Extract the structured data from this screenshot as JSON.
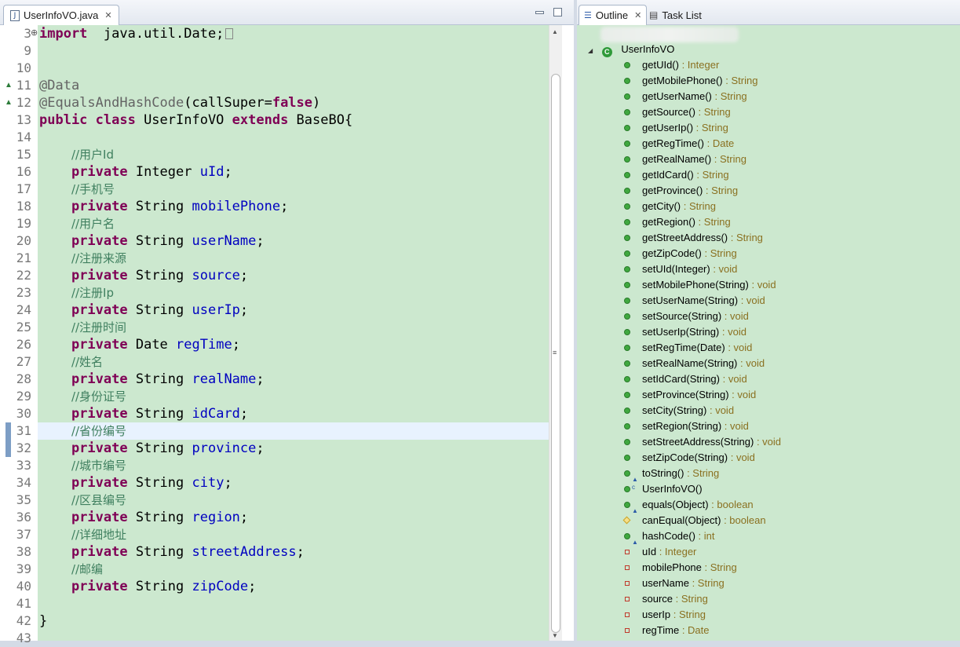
{
  "editor": {
    "tab_label": "UserInfoVO.java",
    "lines": [
      {
        "n": "3",
        "fold": "plus",
        "parts": [
          [
            "kw",
            "import"
          ],
          [
            "",
            "  java.util.Date;"
          ]
        ],
        "box": true
      },
      {
        "n": "9",
        "parts": []
      },
      {
        "n": "10",
        "parts": []
      },
      {
        "n": "11",
        "fold": "tri",
        "parts": [
          [
            "an",
            "@Data"
          ]
        ]
      },
      {
        "n": "12",
        "fold": "tri",
        "parts": [
          [
            "an",
            "@EqualsAndHashCode"
          ],
          [
            "",
            "(callSuper="
          ],
          [
            "kw",
            "false"
          ],
          [
            "",
            ")"
          ]
        ]
      },
      {
        "n": "13",
        "parts": [
          [
            "kw",
            "public class"
          ],
          [
            "",
            " UserInfoVO "
          ],
          [
            "kw",
            "extends"
          ],
          [
            "",
            " BaseBO{"
          ]
        ]
      },
      {
        "n": "14",
        "parts": []
      },
      {
        "n": "15",
        "parts": [
          [
            "",
            "    "
          ],
          [
            "cm",
            "//用户Id"
          ]
        ]
      },
      {
        "n": "16",
        "parts": [
          [
            "",
            "    "
          ],
          [
            "kw",
            "private"
          ],
          [
            "",
            " Integer "
          ],
          [
            "fd",
            "uId"
          ],
          [
            "",
            ";"
          ]
        ]
      },
      {
        "n": "17",
        "parts": [
          [
            "",
            "    "
          ],
          [
            "cm",
            "//手机号"
          ]
        ]
      },
      {
        "n": "18",
        "parts": [
          [
            "",
            "    "
          ],
          [
            "kw",
            "private"
          ],
          [
            "",
            " String "
          ],
          [
            "fd",
            "mobilePhone"
          ],
          [
            "",
            ";"
          ]
        ]
      },
      {
        "n": "19",
        "parts": [
          [
            "",
            "    "
          ],
          [
            "cm",
            "//用户名"
          ]
        ]
      },
      {
        "n": "20",
        "parts": [
          [
            "",
            "    "
          ],
          [
            "kw",
            "private"
          ],
          [
            "",
            " String "
          ],
          [
            "fd",
            "userName"
          ],
          [
            "",
            ";"
          ]
        ]
      },
      {
        "n": "21",
        "parts": [
          [
            "",
            "    "
          ],
          [
            "cm",
            "//注册来源"
          ]
        ]
      },
      {
        "n": "22",
        "parts": [
          [
            "",
            "    "
          ],
          [
            "kw",
            "private"
          ],
          [
            "",
            " String "
          ],
          [
            "fd",
            "source"
          ],
          [
            "",
            ";"
          ]
        ]
      },
      {
        "n": "23",
        "parts": [
          [
            "",
            "    "
          ],
          [
            "cm",
            "//注册Ip"
          ]
        ]
      },
      {
        "n": "24",
        "parts": [
          [
            "",
            "    "
          ],
          [
            "kw",
            "private"
          ],
          [
            "",
            " String "
          ],
          [
            "fd",
            "userIp"
          ],
          [
            "",
            ";"
          ]
        ]
      },
      {
        "n": "25",
        "parts": [
          [
            "",
            "    "
          ],
          [
            "cm",
            "//注册时间"
          ]
        ]
      },
      {
        "n": "26",
        "parts": [
          [
            "",
            "    "
          ],
          [
            "kw",
            "private"
          ],
          [
            "",
            " Date "
          ],
          [
            "fd",
            "regTime"
          ],
          [
            "",
            ";"
          ]
        ]
      },
      {
        "n": "27",
        "parts": [
          [
            "",
            "    "
          ],
          [
            "cm",
            "//姓名"
          ]
        ]
      },
      {
        "n": "28",
        "parts": [
          [
            "",
            "    "
          ],
          [
            "kw",
            "private"
          ],
          [
            "",
            " String "
          ],
          [
            "fd",
            "realName"
          ],
          [
            "",
            ";"
          ]
        ]
      },
      {
        "n": "29",
        "parts": [
          [
            "",
            "    "
          ],
          [
            "cm",
            "//身份证号"
          ]
        ]
      },
      {
        "n": "30",
        "parts": [
          [
            "",
            "    "
          ],
          [
            "kw",
            "private"
          ],
          [
            "",
            " String "
          ],
          [
            "fd",
            "idCard"
          ],
          [
            "",
            ";"
          ]
        ]
      },
      {
        "n": "31",
        "hl": true,
        "parts": [
          [
            "",
            "    "
          ],
          [
            "cm",
            "//省份编号"
          ]
        ]
      },
      {
        "n": "32",
        "parts": [
          [
            "",
            "    "
          ],
          [
            "kw",
            "private"
          ],
          [
            "",
            " String "
          ],
          [
            "fd",
            "province"
          ],
          [
            "",
            ";"
          ]
        ]
      },
      {
        "n": "33",
        "parts": [
          [
            "",
            "    "
          ],
          [
            "cm",
            "//城市编号"
          ]
        ]
      },
      {
        "n": "34",
        "parts": [
          [
            "",
            "    "
          ],
          [
            "kw",
            "private"
          ],
          [
            "",
            " String "
          ],
          [
            "fd",
            "city"
          ],
          [
            "",
            ";"
          ]
        ]
      },
      {
        "n": "35",
        "parts": [
          [
            "",
            "    "
          ],
          [
            "cm",
            "//区县编号"
          ]
        ]
      },
      {
        "n": "36",
        "parts": [
          [
            "",
            "    "
          ],
          [
            "kw",
            "private"
          ],
          [
            "",
            " String "
          ],
          [
            "fd",
            "region"
          ],
          [
            "",
            ";"
          ]
        ]
      },
      {
        "n": "37",
        "parts": [
          [
            "",
            "    "
          ],
          [
            "cm",
            "//详细地址"
          ]
        ]
      },
      {
        "n": "38",
        "parts": [
          [
            "",
            "    "
          ],
          [
            "kw",
            "private"
          ],
          [
            "",
            " String "
          ],
          [
            "fd",
            "streetAddress"
          ],
          [
            "",
            ";"
          ]
        ]
      },
      {
        "n": "39",
        "parts": [
          [
            "",
            "    "
          ],
          [
            "cm",
            "//邮编"
          ]
        ]
      },
      {
        "n": "40",
        "parts": [
          [
            "",
            "    "
          ],
          [
            "kw",
            "private"
          ],
          [
            "",
            " String "
          ],
          [
            "fd",
            "zipCode"
          ],
          [
            "",
            ";"
          ]
        ]
      },
      {
        "n": "41",
        "parts": []
      },
      {
        "n": "42",
        "parts": [
          [
            "",
            "}"
          ]
        ]
      },
      {
        "n": "43",
        "parts": []
      }
    ]
  },
  "outline": {
    "tab_outline": "Outline",
    "tab_tasks": "Task List",
    "root": "UserInfoVO",
    "items": [
      {
        "name": "getUId()",
        "type": " : Integer",
        "icon": "pub"
      },
      {
        "name": "getMobilePhone()",
        "type": " : String",
        "icon": "pub"
      },
      {
        "name": "getUserName()",
        "type": " : String",
        "icon": "pub"
      },
      {
        "name": "getSource()",
        "type": " : String",
        "icon": "pub"
      },
      {
        "name": "getUserIp()",
        "type": " : String",
        "icon": "pub"
      },
      {
        "name": "getRegTime()",
        "type": " : Date",
        "icon": "pub"
      },
      {
        "name": "getRealName()",
        "type": " : String",
        "icon": "pub"
      },
      {
        "name": "getIdCard()",
        "type": " : String",
        "icon": "pub"
      },
      {
        "name": "getProvince()",
        "type": " : String",
        "icon": "pub"
      },
      {
        "name": "getCity()",
        "type": " : String",
        "icon": "pub"
      },
      {
        "name": "getRegion()",
        "type": " : String",
        "icon": "pub"
      },
      {
        "name": "getStreetAddress()",
        "type": " : String",
        "icon": "pub"
      },
      {
        "name": "getZipCode()",
        "type": " : String",
        "icon": "pub"
      },
      {
        "name": "setUId(Integer)",
        "type": " : void",
        "icon": "pub"
      },
      {
        "name": "setMobilePhone(String)",
        "type": " : void",
        "icon": "pub"
      },
      {
        "name": "setUserName(String)",
        "type": " : void",
        "icon": "pub"
      },
      {
        "name": "setSource(String)",
        "type": " : void",
        "icon": "pub"
      },
      {
        "name": "setUserIp(String)",
        "type": " : void",
        "icon": "pub"
      },
      {
        "name": "setRegTime(Date)",
        "type": " : void",
        "icon": "pub"
      },
      {
        "name": "setRealName(String)",
        "type": " : void",
        "icon": "pub"
      },
      {
        "name": "setIdCard(String)",
        "type": " : void",
        "icon": "pub"
      },
      {
        "name": "setProvince(String)",
        "type": " : void",
        "icon": "pub"
      },
      {
        "name": "setCity(String)",
        "type": " : void",
        "icon": "pub"
      },
      {
        "name": "setRegion(String)",
        "type": " : void",
        "icon": "pub"
      },
      {
        "name": "setStreetAddress(String)",
        "type": " : void",
        "icon": "pub"
      },
      {
        "name": "setZipCode(String)",
        "type": " : void",
        "icon": "pub"
      },
      {
        "name": "toString()",
        "type": " : String",
        "icon": "pub",
        "over": true
      },
      {
        "name": "UserInfoVO()",
        "type": "",
        "icon": "pub",
        "ctor": true
      },
      {
        "name": "equals(Object)",
        "type": " : boolean",
        "icon": "pub",
        "over": true
      },
      {
        "name": "canEqual(Object)",
        "type": " : boolean",
        "icon": "prot"
      },
      {
        "name": "hashCode()",
        "type": " : int",
        "icon": "pub",
        "over": true
      },
      {
        "name": "uId",
        "type": " : Integer",
        "icon": "priv"
      },
      {
        "name": "mobilePhone",
        "type": " : String",
        "icon": "priv"
      },
      {
        "name": "userName",
        "type": " : String",
        "icon": "priv"
      },
      {
        "name": "source",
        "type": " : String",
        "icon": "priv"
      },
      {
        "name": "userIp",
        "type": " : String",
        "icon": "priv"
      },
      {
        "name": "regTime",
        "type": " : Date",
        "icon": "priv"
      }
    ]
  },
  "colors": {
    "editor_bg": "#cce8cf",
    "keyword": "#7f0055",
    "field": "#0000c0",
    "comment": "#3f7f5f",
    "annotation": "#646464"
  }
}
